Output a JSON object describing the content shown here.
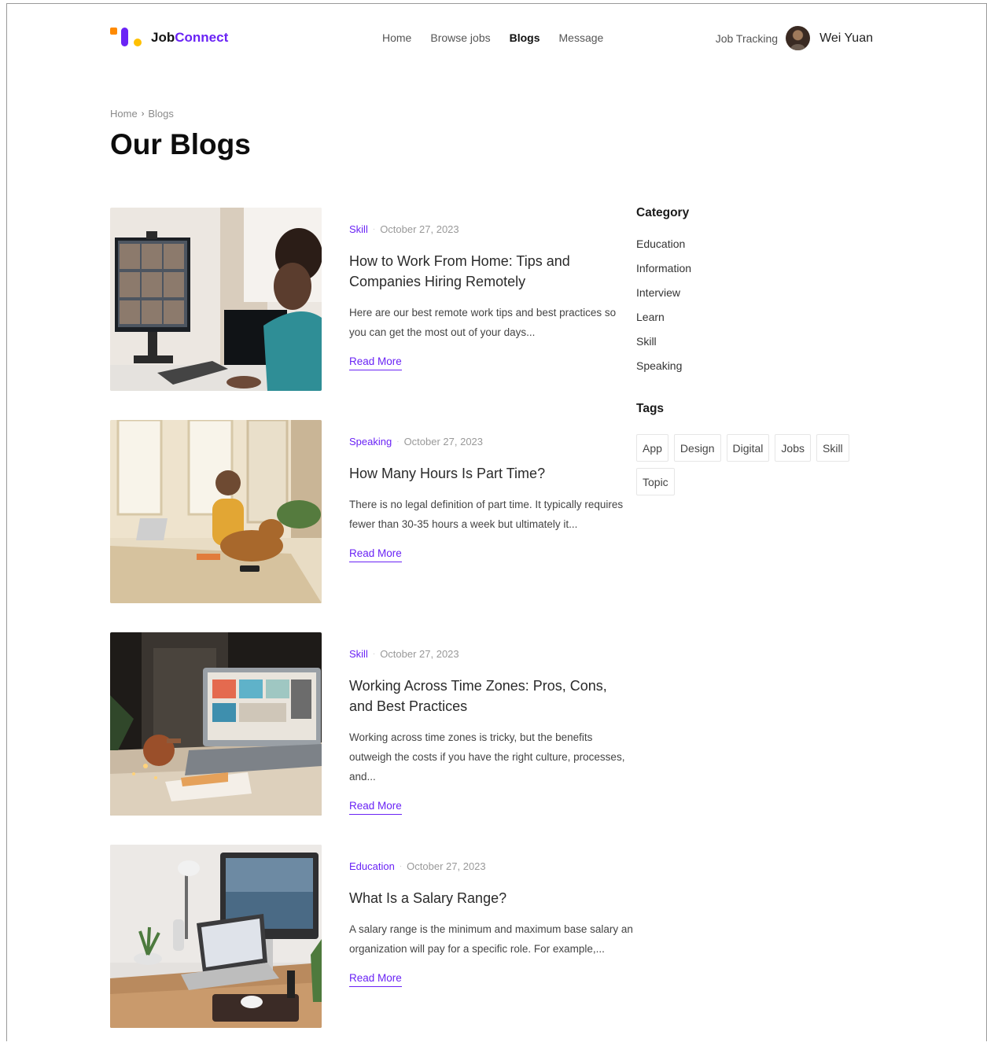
{
  "header": {
    "logo_prefix": "Job",
    "logo_accent": "Connect",
    "nav": [
      {
        "label": "Home",
        "active": false
      },
      {
        "label": "Browse jobs",
        "active": false
      },
      {
        "label": "Blogs",
        "active": true
      },
      {
        "label": "Message",
        "active": false
      }
    ],
    "job_tracking": "Job Tracking",
    "user_name": "Wei Yuan"
  },
  "breadcrumb": {
    "home": "Home",
    "separator": "›",
    "current": "Blogs"
  },
  "page_title": "Our Blogs",
  "posts": [
    {
      "category": "Skill",
      "date": "October 27, 2023",
      "title": "How to Work From Home: Tips and Companies Hiring Remotely",
      "excerpt": "Here are our best remote work tips and best practices so you can get the most out of your days...",
      "read_more": "Read More"
    },
    {
      "category": "Speaking",
      "date": "October 27, 2023",
      "title": "How Many Hours Is Part Time?",
      "excerpt": "There is no legal definition of part time. It typically requires fewer than 30-35 hours a week but ultimately it...",
      "read_more": "Read More"
    },
    {
      "category": "Skill",
      "date": "October 27, 2023",
      "title": "Working Across Time Zones: Pros, Cons, and Best Practices",
      "excerpt": "Working across time zones is tricky, but the benefits outweigh the costs if you have the right culture, processes, and...",
      "read_more": "Read More"
    },
    {
      "category": "Education",
      "date": "October 27, 2023",
      "title": "What Is a Salary Range?",
      "excerpt": "A salary range is the minimum and maximum base salary an organization will pay for a specific role. For example,...",
      "read_more": "Read More"
    }
  ],
  "sidebar": {
    "category_heading": "Category",
    "categories": [
      "Education",
      "Information",
      "Interview",
      "Learn",
      "Skill",
      "Speaking"
    ],
    "tags_heading": "Tags",
    "tags": [
      "App",
      "Design",
      "Digital",
      "Jobs",
      "Skill",
      "Topic"
    ]
  },
  "colors": {
    "accent": "#6a23f5",
    "logo_orange": "#ff8a00",
    "logo_yellow": "#ffc000"
  }
}
